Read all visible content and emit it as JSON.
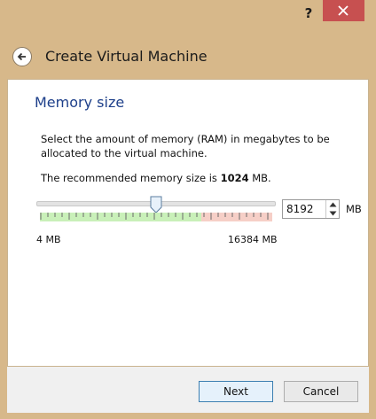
{
  "titlebar": {
    "help_label": "?",
    "close_icon": "close-icon"
  },
  "wizard": {
    "title": "Create Virtual Machine",
    "back_icon": "back-arrow-icon"
  },
  "page": {
    "heading": "Memory size",
    "description": "Select the amount of memory (RAM) in megabytes to be allocated to the virtual machine.",
    "recommend_prefix": "The recommended memory size is ",
    "recommend_value": "1024",
    "recommend_suffix": " MB."
  },
  "memory": {
    "value": "8192",
    "unit": "MB",
    "min_label": "4 MB",
    "max_label": "16384 MB",
    "slider_value_mb": 8192,
    "slider_min_mb": 4,
    "slider_max_mb": 16384,
    "safe_zone_color": "#c9f0b9",
    "warn_zone_color": "#f6cfc7"
  },
  "buttons": {
    "next_label": "Next",
    "cancel_label": "Cancel"
  },
  "colors": {
    "frame": "#d7b88a",
    "close_button": "#c75050",
    "heading": "#1d3f8a"
  }
}
